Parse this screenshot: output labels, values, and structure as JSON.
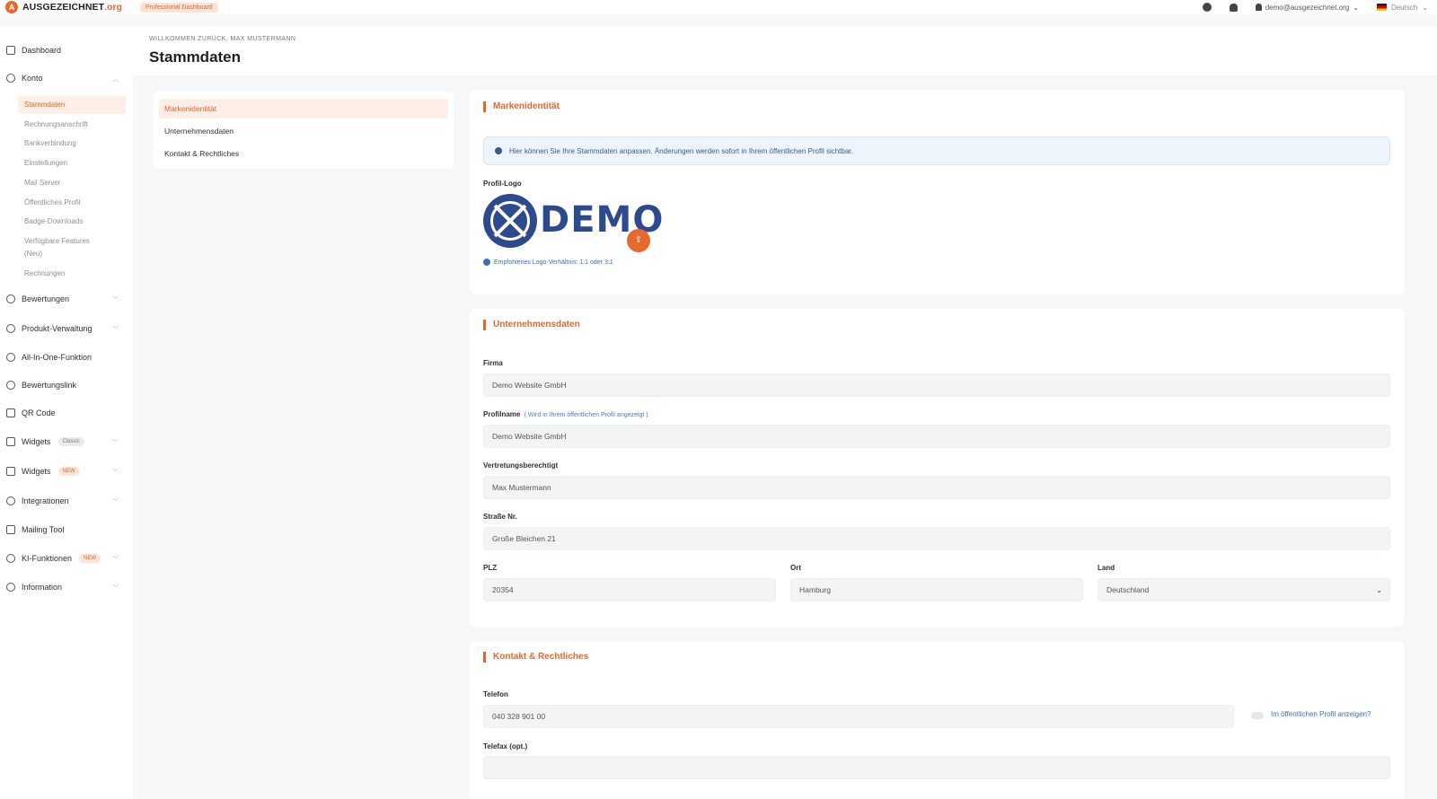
{
  "topbar": {
    "brand": "AUSGEZEICHNET",
    "brand_tld": ".org",
    "brand_mark": "A",
    "badge": "Professional Dashboard",
    "user_email": "demo@ausgezeichnet.org",
    "language": "Deutsch",
    "icons": [
      "globe-icon",
      "bell-icon",
      "user-icon",
      "flag-de-icon"
    ]
  },
  "sidebar": {
    "items": [
      {
        "label": "Dashboard",
        "icon": "dashboard-icon"
      },
      {
        "label": "Konto",
        "icon": "user-icon"
      },
      {
        "label": "Bewertungen",
        "icon": "star-icon"
      },
      {
        "label": "Produkt-Verwaltung",
        "icon": "box-icon"
      },
      {
        "label": "All-In-One-Funktion",
        "icon": "circle-icon"
      },
      {
        "label": "Bewertungslink",
        "icon": "link-icon"
      },
      {
        "label": "QR Code",
        "icon": "qr-code-icon"
      },
      {
        "label": "Widgets",
        "icon": "code-icon",
        "badge": "Classic"
      },
      {
        "label": "Widgets",
        "icon": "chart-icon",
        "badge": "NEW"
      },
      {
        "label": "Integrationen",
        "icon": "refresh-icon"
      },
      {
        "label": "Mailing Tool",
        "icon": "mail-icon"
      },
      {
        "label": "KI-Funktionen",
        "icon": "eye-icon",
        "badge": "NEW"
      },
      {
        "label": "Information",
        "icon": "info-icon"
      }
    ],
    "konto_sub": [
      {
        "label": "Stammdaten"
      },
      {
        "label": "Rechnungsanschrift"
      },
      {
        "label": "Bankverbindung"
      },
      {
        "label": "Einstellungen"
      },
      {
        "label": "Mail Server"
      },
      {
        "label": "Öffentliches Profil"
      },
      {
        "label": "Badge-Downloads"
      },
      {
        "label": "Verfügbare Features (Neu)"
      },
      {
        "label": "Rechnungen"
      }
    ]
  },
  "header": {
    "welcome": "WILLKOMMEN ZURÜCK, MAX MUSTERMANN",
    "title": "Stammdaten"
  },
  "tabs": [
    {
      "label": "Markenidentität"
    },
    {
      "label": "Unternehmensdaten"
    },
    {
      "label": "Kontakt & Rechtliches"
    }
  ],
  "brand_card": {
    "title": "Markenidentität",
    "info": "Hier können Sie Ihre Stammdaten anpassen. Änderungen werden sofort in Ihrem öffentlichen Profil sichtbar.",
    "logo_label": "Profil-Logo",
    "logo_text": "DEMO",
    "upload_icon": "upload-icon",
    "logo_hint": "Empfohlenes Logo-Verhältnis: 1:1 oder 3:1"
  },
  "company_card": {
    "title": "Unternehmensdaten",
    "firma_label": "Firma",
    "firma_value": "Demo Website GmbH",
    "profilname_label": "Profilname",
    "profilname_note": "( Wird in Ihrem öffentlichen Profil angezeigt )",
    "profilname_value": "Demo Website GmbH",
    "vertretung_label": "Vertretungsberechtigt",
    "vertretung_value": "Max Mustermann",
    "strasse_label": "Straße Nr.",
    "strasse_value": "Große Bleichen 21",
    "plz_label": "PLZ",
    "plz_value": "20354",
    "ort_label": "Ort",
    "ort_value": "Hamburg",
    "land_label": "Land",
    "land_value": "Deutschland"
  },
  "contact_card": {
    "title": "Kontakt & Rechtliches",
    "telefon_label": "Telefon",
    "telefon_value": "040 328 901 00",
    "toggle_label": "Im öffentlichen Profil anzeigen?",
    "telefax_label": "Telefax (opt.)",
    "telefax_value": ""
  },
  "colors": {
    "accent": "#e2672e",
    "link": "#3b6fc0",
    "logo_blue": "#2d4a8f"
  }
}
